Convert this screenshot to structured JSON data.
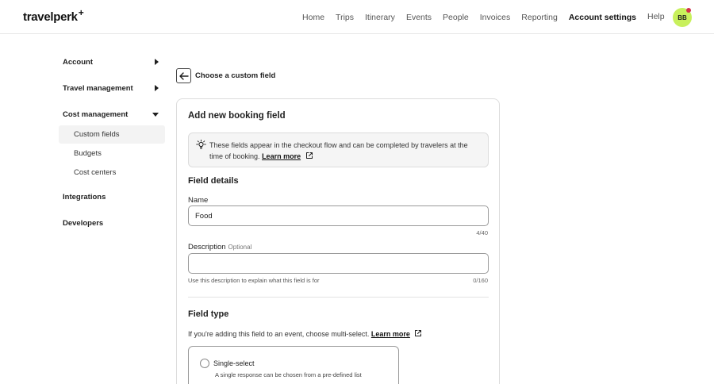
{
  "header": {
    "logo": "travelperk",
    "logo_mark": "+",
    "nav": [
      "Home",
      "Trips",
      "Itinerary",
      "Events",
      "People",
      "Invoices",
      "Reporting",
      "Account settings"
    ],
    "help": "Help",
    "avatar_initials": "BB"
  },
  "sidebar": {
    "sections": [
      {
        "label": "Account"
      },
      {
        "label": "Travel management"
      },
      {
        "label": "Cost management",
        "children": [
          "Custom fields",
          "Budgets",
          "Cost centers"
        ]
      },
      {
        "label": "Integrations"
      },
      {
        "label": "Developers"
      }
    ]
  },
  "page": {
    "back_title": "Choose a custom field",
    "card_title": "Add new booking field",
    "info_text": "These fields appear in the checkout flow and can be completed by travelers at the time of booking.",
    "info_link": "Learn more",
    "field_details_title": "Field details",
    "name_label": "Name",
    "name_value": "Food",
    "name_counter": "4/40",
    "description_label": "Description",
    "description_optional": "Optional",
    "description_value": "",
    "description_hint": "Use this description to explain what this field is for",
    "description_counter": "0/160",
    "field_type_title": "Field type",
    "field_type_desc": "If you're adding this field to an event, choose multi-select.",
    "field_type_link": "Learn more",
    "option_single_title": "Single-select",
    "option_single_desc": "A single response can be chosen from a pre-defined list"
  },
  "colors": {
    "avatar_bg": "#c8f05c",
    "notification_dot": "#d2344a",
    "info_bg": "#f5f5f5",
    "active_sidebar_bg": "#f3f3f3"
  }
}
